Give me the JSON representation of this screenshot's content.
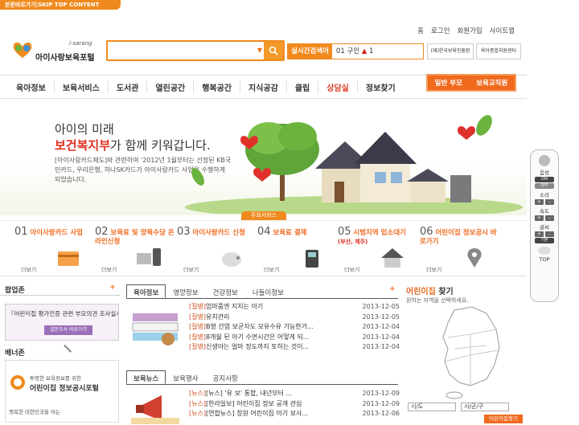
{
  "skip_link": "본문바로가기|SKIP TOP CONTENT",
  "top_links": [
    "홈",
    "로그인",
    "회원가입",
    "사이트맵"
  ],
  "logo": {
    "sub": "i-sarang",
    "name": "아이사랑보육포털"
  },
  "search": {
    "placeholder": "",
    "dropdown": "▼"
  },
  "realtime": {
    "label": "실시간검색어",
    "rank": "01",
    "term": "구인",
    "arrow": "▲",
    "change": "1"
  },
  "partner_banners": [
    "(재)한국보육진흥원",
    "육아종합지원센터"
  ],
  "gnb": [
    "육아정보",
    "보육서비스",
    "도서관",
    "열린공간",
    "행복공간",
    "지식공감",
    "클립",
    "상담실",
    "정보찾기"
  ],
  "user_tabs": [
    "일반 부모",
    "보육교직원"
  ],
  "hero": {
    "line1": "아이의 미래",
    "line2_bold": "보건복지부",
    "line2_rest": "가 함께 키워갑니다.",
    "desc": "[아이사랑카드제도]와 관련하여 '2012년 1월부터는 선정된 KB국민카드, 우리은행, 하나SK카드가 아이사랑카드 사업을 수행하게 되었습니다."
  },
  "main_services_label": "주요서비스",
  "services": [
    {
      "num": "01",
      "title": "아이사랑카드 사업",
      "sub": "",
      "more": "더보기"
    },
    {
      "num": "02",
      "title": "보육료 및 양육수당 온라인신청",
      "sub": "",
      "more": "더보기"
    },
    {
      "num": "03",
      "title": "아이사랑카드 신청",
      "sub": "",
      "more": "더보기"
    },
    {
      "num": "04",
      "title": "보육료 결제",
      "sub": "",
      "more": "더보기"
    },
    {
      "num": "05",
      "title": "시범지역 입소대기",
      "sub": "(부산, 제주)",
      "more": "더보기"
    },
    {
      "num": "06",
      "title": "어린이집 정보공시 바로가기",
      "sub": "",
      "more": "더보기"
    }
  ],
  "remote": {
    "voice": "음성",
    "on": "ON",
    "off": "OFF",
    "volume": "소리",
    "speed": "속도",
    "font": "글씨",
    "reset": "기본",
    "top": "TOP"
  },
  "popup_zone": {
    "title": "팝업존",
    "banner_text": "『어린이집 평가인증 관련 부모의견 조사실시',",
    "banner_btn": "설문조사 바로가기",
    "banner_zone_title": "배너존",
    "banner2_sub": "투명한 보육정보를 위한",
    "banner2_title": "어린이집 정보공시포털",
    "banner2_bottom": "행복한 대한민국을 여는"
  },
  "parenting_tabs": [
    "육아정보",
    "영양정보",
    "건강정보",
    "나들이정보"
  ],
  "parenting_news": [
    {
      "cat": "[질병]",
      "title": "엄마품엔 지치는 아기",
      "date": "2013-12-05"
    },
    {
      "cat": "[질병]",
      "title": "유치관리",
      "date": "2013-12-05"
    },
    {
      "cat": "[질병]",
      "title": "B형 간염 보균자도 모유수유 가능한가...",
      "date": "2013-12-04"
    },
    {
      "cat": "[질병]",
      "title": "8개월 된 아기 수면시간은 어떻게 되...",
      "date": "2013-12-04"
    },
    {
      "cat": "[질병]",
      "title": "신생아는 얼마 정도까지 토하는 것이...",
      "date": "2013-12-04"
    }
  ],
  "childcare_tabs": [
    "보육뉴스",
    "보육행사",
    "공지사항"
  ],
  "childcare_news": [
    {
      "cat": "[뉴스]",
      "title": "[뉴스] '유 보' 통합, 내년부터 ...",
      "date": "2013-12-09"
    },
    {
      "cat": "[뉴스]",
      "title": "[한라일보] 어린이집 정보 공개 관심",
      "date": "2013-12-09"
    },
    {
      "cat": "[뉴스]",
      "title": "[연합뉴스] 창원 어린이집 아기 보사...",
      "date": "2013-12-06"
    }
  ],
  "daycare": {
    "title_prefix": "어린이집",
    "title_suffix": " 찾기",
    "subtitle": "원하는 지역을 선택하세요.",
    "sido": "시/도",
    "sigungu": "시/군/구",
    "go": "어린이집찾기"
  },
  "colors": {
    "accent": "#f08a1e",
    "highlight": "#e03020"
  }
}
